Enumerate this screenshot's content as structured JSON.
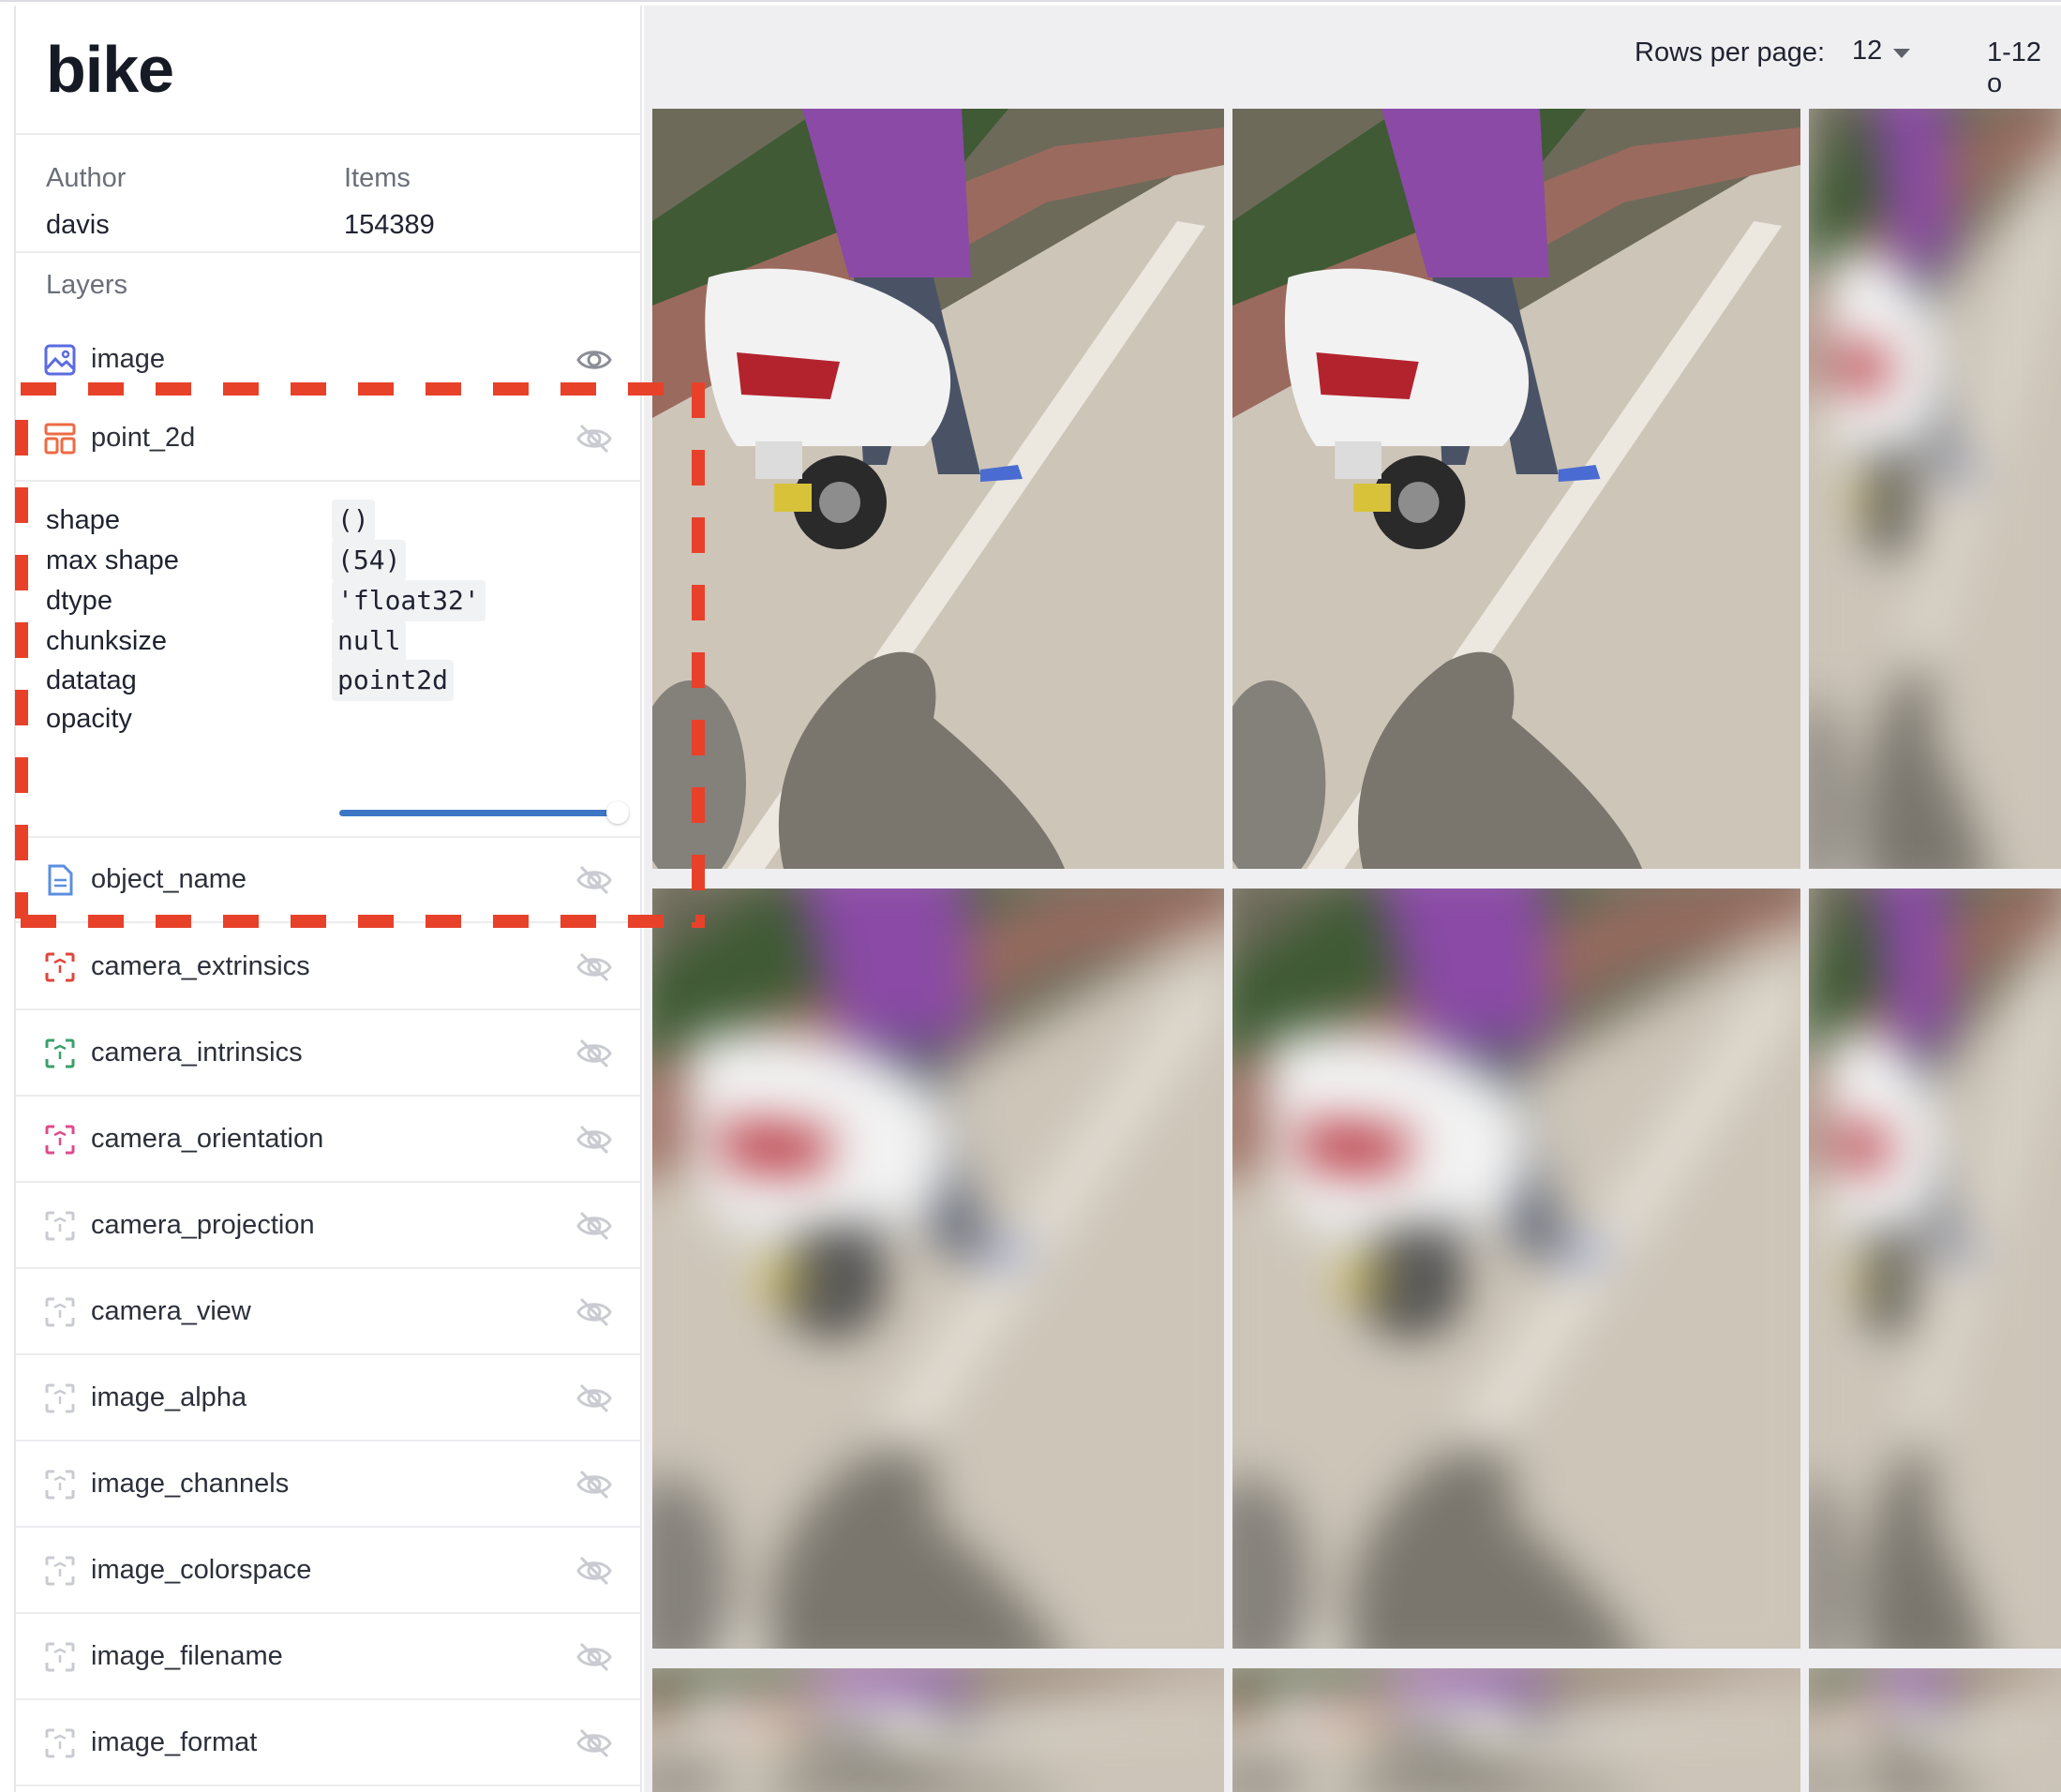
{
  "dataset": {
    "title": "bike",
    "author_label": "Author",
    "author": "davis",
    "items_label": "Items",
    "items": "154389"
  },
  "layers_label": "Layers",
  "layers": [
    {
      "name": "image",
      "icon": "image-icon",
      "visible": true
    },
    {
      "name": "point_2d",
      "icon": "layout-icon",
      "visible": false,
      "expanded": true
    },
    {
      "name": "object_name",
      "icon": "document-icon",
      "visible": false
    },
    {
      "name": "camera_extrinsics",
      "icon": "camera-frame-icon",
      "visible": false,
      "color": "#e0453b"
    },
    {
      "name": "camera_intrinsics",
      "icon": "camera-frame-icon",
      "visible": false,
      "color": "#3aa06b"
    },
    {
      "name": "camera_orientation",
      "icon": "camera-frame-icon",
      "visible": false,
      "color": "#e04b8a"
    },
    {
      "name": "camera_projection",
      "icon": "camera-frame-icon",
      "visible": false,
      "color": "#c9cbd1"
    },
    {
      "name": "camera_view",
      "icon": "camera-frame-icon",
      "visible": false,
      "color": "#c9cbd1"
    },
    {
      "name": "image_alpha",
      "icon": "camera-frame-icon",
      "visible": false,
      "color": "#c9cbd1"
    },
    {
      "name": "image_channels",
      "icon": "camera-frame-icon",
      "visible": false,
      "color": "#c9cbd1"
    },
    {
      "name": "image_colorspace",
      "icon": "camera-frame-icon",
      "visible": false,
      "color": "#c9cbd1"
    },
    {
      "name": "image_filename",
      "icon": "camera-frame-icon",
      "visible": false,
      "color": "#c9cbd1"
    },
    {
      "name": "image_format",
      "icon": "camera-frame-icon",
      "visible": false,
      "color": "#c9cbd1"
    }
  ],
  "point_2d_props": {
    "shape_label": "shape",
    "shape": "()",
    "max_shape_label": "max shape",
    "max_shape": "(54)",
    "dtype_label": "dtype",
    "dtype": "'float32'",
    "chunksize_label": "chunksize",
    "chunksize": "null",
    "datatag_label": "datatag",
    "datatag": "point2d",
    "opacity_label": "opacity",
    "opacity": 1.0
  },
  "pagination": {
    "rows_label": "Rows per page:",
    "rows_value": "12",
    "range": "1-12 o"
  },
  "colors": {
    "accent": "#3e76c6",
    "annotation": "#e8412a",
    "image_icon": "#5b6be0",
    "layout_icon": "#ee6a44",
    "document_icon": "#5b8fe0"
  }
}
